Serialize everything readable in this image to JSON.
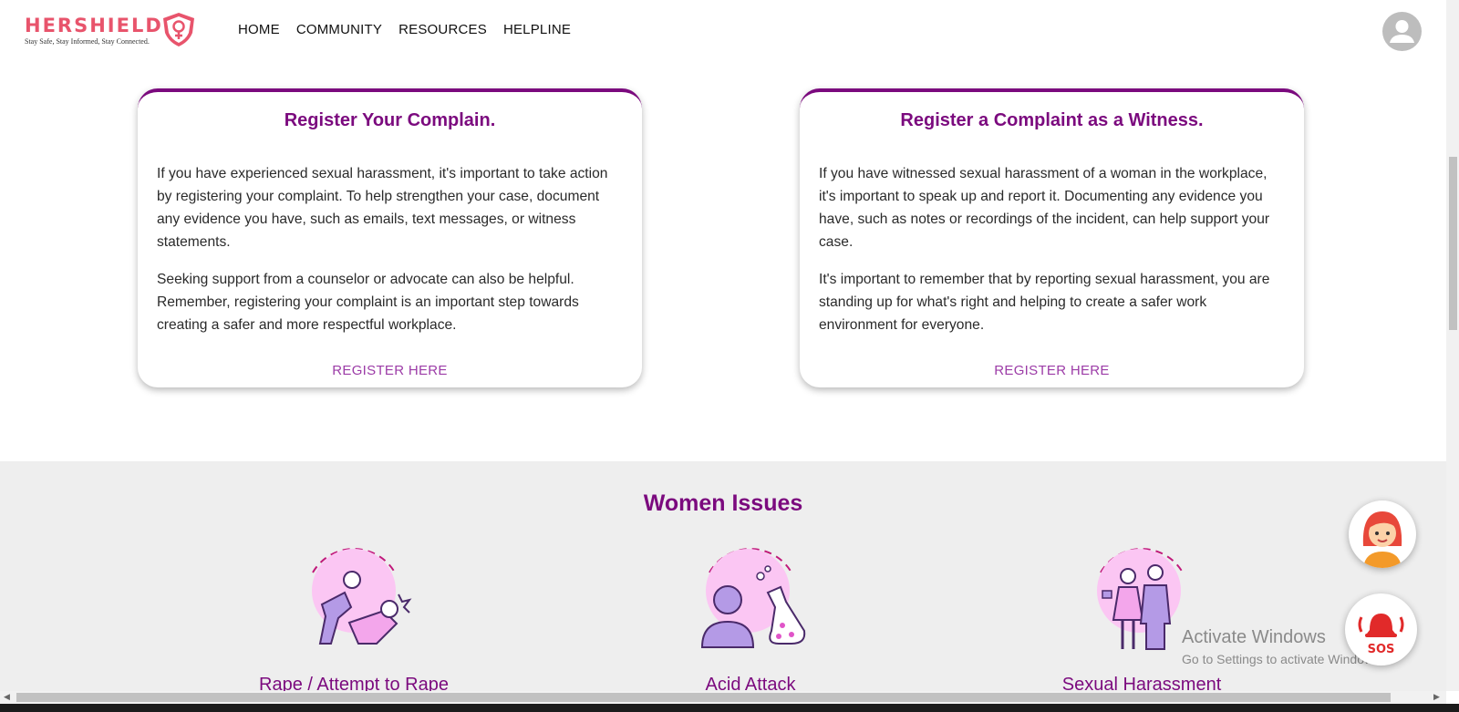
{
  "brand": {
    "name": "HERSHIELD",
    "tagline": "Stay Safe, Stay Informed, Stay Connected."
  },
  "nav": {
    "items": [
      "HOME",
      "COMMUNITY",
      "RESOURCES",
      "HELPLINE"
    ]
  },
  "cards": [
    {
      "title": "Register Your Complain.",
      "paragraphs": [
        "If you have experienced sexual harassment, it's important to take action by registering your complaint. To help strengthen your case, document any evidence you have, such as emails, text messages, or witness statements.",
        "Seeking support from a counselor or advocate can also be helpful. Remember, registering your complaint is an important step towards creating a safer and more respectful workplace."
      ],
      "link": "REGISTER HERE"
    },
    {
      "title": "Register a Complaint as a Witness.",
      "paragraphs": [
        "If you have witnessed sexual harassment of a woman in the workplace, it's important to speak up and report it. Documenting any evidence you have, such as notes or recordings of the incident, can help support your case.",
        "It's important to remember that by reporting sexual harassment, you are standing up for what's right and helping to create a safer work environment for everyone."
      ],
      "link": "REGISTER HERE"
    }
  ],
  "issues": {
    "title": "Women Issues",
    "items": [
      {
        "label": "Rape / Attempt to Rape",
        "icon": "assault-icon"
      },
      {
        "label": "Acid Attack",
        "icon": "acid-attack-icon"
      },
      {
        "label": "Sexual Harassment",
        "icon": "harassment-icon"
      }
    ]
  },
  "floating": {
    "sos_label": "SOS",
    "chat_icon": "assistant-avatar-icon"
  },
  "watermark": {
    "line1": "Activate Windows",
    "line2": "Go to Settings to activate Windows."
  },
  "colors": {
    "accent": "#7b0a7e",
    "brand": "#e8546c",
    "link": "#9c3ca7",
    "issue_bg": "#eeeeee"
  }
}
